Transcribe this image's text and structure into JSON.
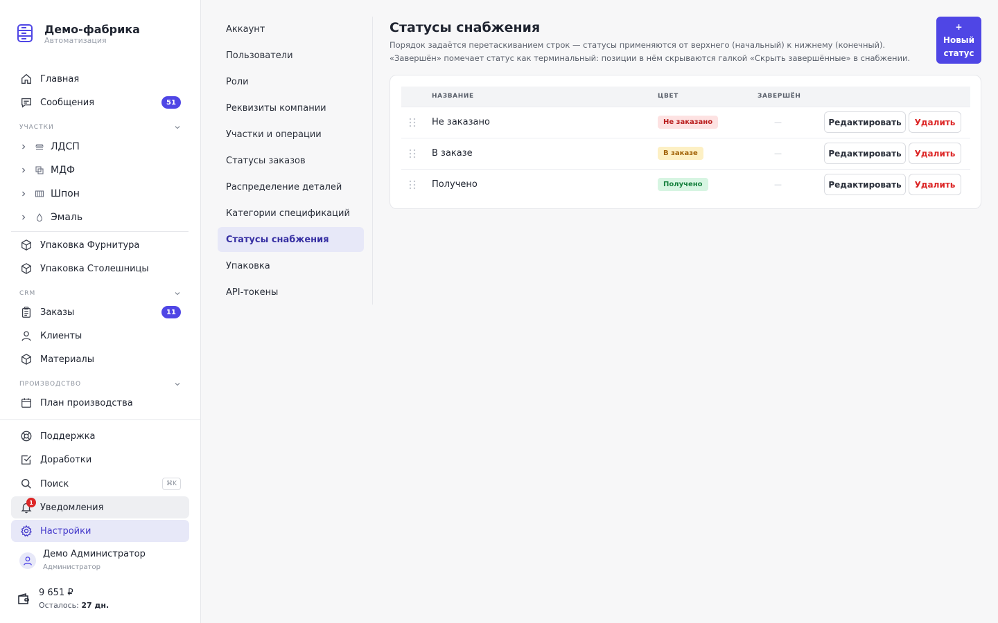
{
  "brand": {
    "title": "Демо-фабрика",
    "subtitle": "Автоматизация",
    "icon": "server-stack-icon"
  },
  "nav": {
    "home": "Главная",
    "messages": "Сообщения",
    "messages_count": "51"
  },
  "sections": {
    "areas": "УЧАСТКИ",
    "crm": "CRM",
    "production": "ПРОИЗВОДСТВО"
  },
  "areas": [
    "ЛДСП",
    "МДФ",
    "Шпон",
    "Эмаль"
  ],
  "packaging": [
    "Упаковка Фурнитура",
    "Упаковка Столешницы"
  ],
  "crm": {
    "orders": "Заказы",
    "orders_count": "11",
    "clients": "Клиенты",
    "materials": "Материалы"
  },
  "production": {
    "plan": "План производства"
  },
  "bottom": {
    "support": "Поддержка",
    "improvements": "Доработки",
    "search": "Поиск",
    "search_kbd": "⌘K",
    "notifications": "Уведомления",
    "notifications_count": "1",
    "settings": "Настройки"
  },
  "user": {
    "name": "Демо Администратор",
    "role": "Администратор"
  },
  "wallet": {
    "amount": "9 651 ₽",
    "left_label": "Осталось:",
    "left_value": "27 дн."
  },
  "settings_nav": [
    "Аккаунт",
    "Пользователи",
    "Роли",
    "Реквизиты компании",
    "Участки и операции",
    "Статусы заказов",
    "Распределение деталей",
    "Категории спецификаций",
    "Статусы снабжения",
    "Упаковка",
    "API-токены"
  ],
  "settings_nav_active": "Статусы снабжения",
  "page": {
    "title": "Статусы снабжения",
    "description": "Порядок задаётся перетаскиванием строк — статусы применяются от верхнего (начальный) к нижнему (конечный). «Завершён» помечает статус как терминальный: позиции в нём скрываются галкой «Скрыть завершённые» в снабжении.",
    "new_button": {
      "plus": "+",
      "line1": "Новый",
      "line2": "статус"
    }
  },
  "table": {
    "headers": {
      "name": "НАЗВАНИЕ",
      "color": "ЦВЕТ",
      "done": "ЗАВЕРШЁН"
    },
    "rows": [
      {
        "name": "Не заказано",
        "badge": "Не заказано",
        "done": "—",
        "badge_bg": "#fde2e2",
        "badge_fg": "#b91c1c"
      },
      {
        "name": "В заказе",
        "badge": "В заказе",
        "done": "—",
        "badge_bg": "#fdf0c4",
        "badge_fg": "#a16207"
      },
      {
        "name": "Получено",
        "badge": "Получено",
        "done": "—",
        "badge_bg": "#d7f5e2",
        "badge_fg": "#15803d"
      }
    ],
    "edit_label": "Редактировать",
    "delete_label": "Удалить"
  },
  "colors": {
    "accent": "#4f46e5",
    "danger": "#dc2626"
  }
}
